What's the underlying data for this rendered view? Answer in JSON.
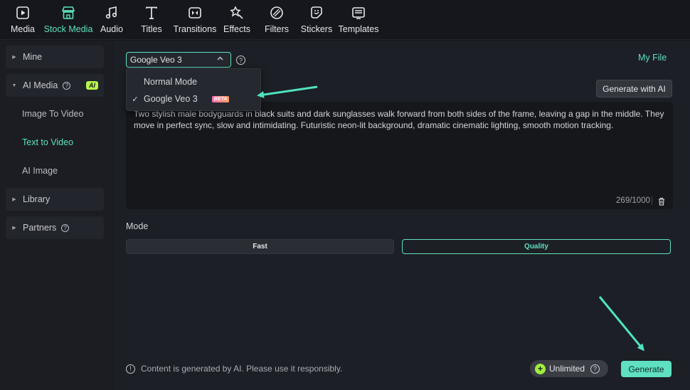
{
  "toolbar": {
    "items": [
      {
        "label": "Media",
        "icon": "media-icon"
      },
      {
        "label": "Stock Media",
        "icon": "stock-media-icon"
      },
      {
        "label": "Audio",
        "icon": "music-note-icon"
      },
      {
        "label": "Titles",
        "icon": "text-t-icon"
      },
      {
        "label": "Transitions",
        "icon": "transitions-icon"
      },
      {
        "label": "Effects",
        "icon": "effects-icon"
      },
      {
        "label": "Filters",
        "icon": "filters-icon"
      },
      {
        "label": "Stickers",
        "icon": "stickers-icon"
      },
      {
        "label": "Templates",
        "icon": "templates-icon"
      }
    ],
    "active": "Stock Media"
  },
  "sidebar": {
    "mine": "Mine",
    "ai_media": "AI Media",
    "ai_badge": "AI",
    "sub": {
      "image_to_video": "Image To Video",
      "text_to_video": "Text to Video",
      "ai_image": "AI Image"
    },
    "library": "Library",
    "partners": "Partners"
  },
  "model": {
    "selected": "Google Veo 3",
    "options": [
      {
        "label": "Normal Mode",
        "checked": false
      },
      {
        "label": "Google Veo 3",
        "checked": true,
        "badge": "BETA"
      }
    ]
  },
  "my_file": "My File",
  "generate_with_ai": "Generate with AI",
  "prompt": {
    "text": "Two stylish male bodyguards in black suits and dark sunglasses walk forward from both sides of the frame, leaving a gap in the middle. They move in perfect sync, slow and intimidating. Futuristic neon-lit background, dramatic cinematic lighting, smooth motion tracking.",
    "counter": "269/1000"
  },
  "mode": {
    "label": "Mode",
    "fast": "Fast",
    "quality": "Quality",
    "selected": "Quality"
  },
  "notice": "Content is generated by AI. Please use it responsibly.",
  "unlimited": "Unlimited",
  "generate": "Generate",
  "colors": {
    "accent": "#5fe0c0",
    "background": "#1c1f25",
    "ai_badge": "#b8f54a"
  }
}
